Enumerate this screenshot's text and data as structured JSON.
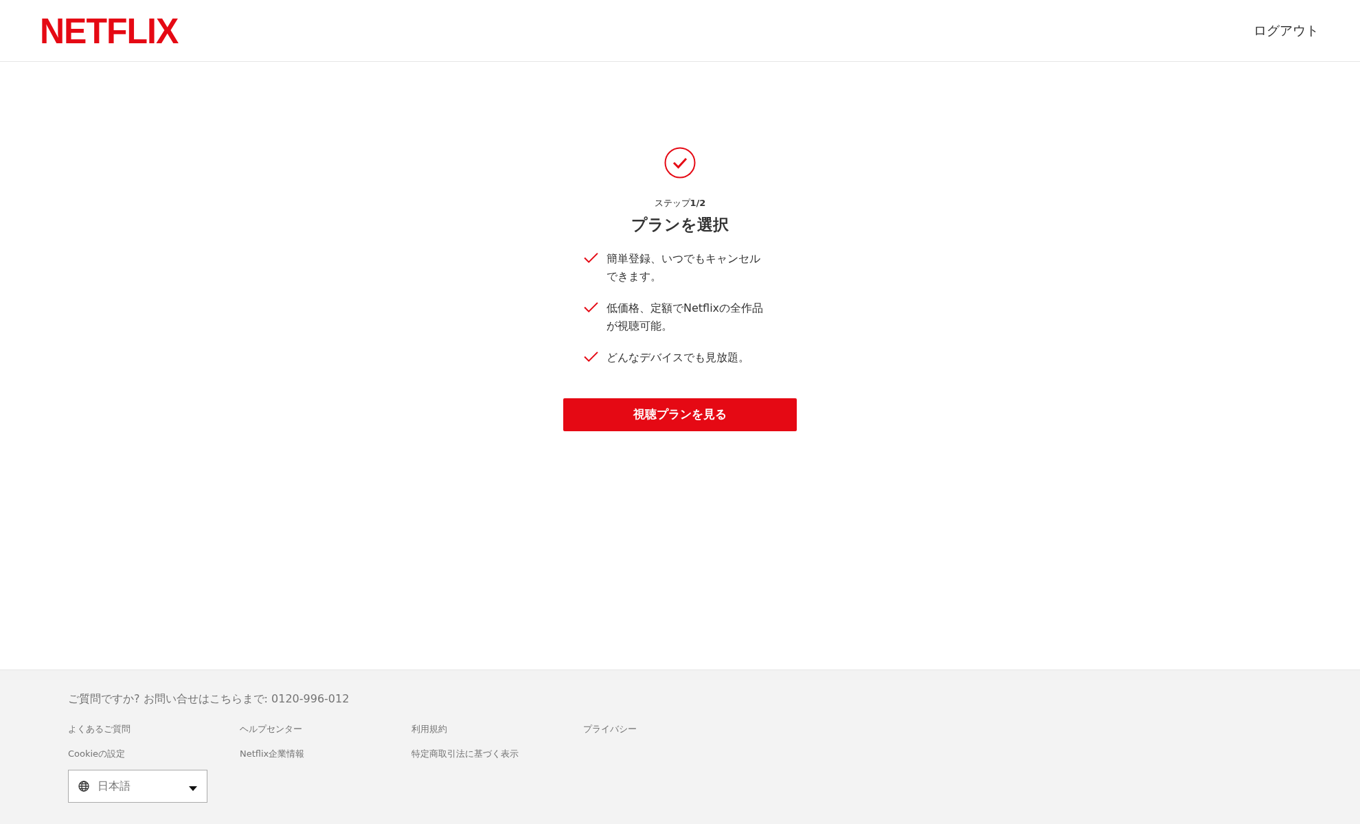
{
  "header": {
    "logo": "NETFLIX",
    "logout": "ログアウト"
  },
  "main": {
    "step": "ステップ**1/2**",
    "title": "プランを選択",
    "benefits": [
      {
        "text": "簡単登録、いつでもキャンセルできます。"
      },
      {
        "text": "低価格、定額でNetflixの全作品が視聴可能。"
      },
      {
        "text": "どんなデバイスでも見放題。"
      }
    ],
    "button": "視聴プランを見る"
  },
  "footer": {
    "contact": "ご質問ですか? お問い合せはこちらまで: 0120-996-012",
    "links": [
      "よくあるご質問",
      "ヘルプセンター",
      "利用規約",
      "プライバシー",
      "Cookieの設定",
      "Netflix企業情報",
      "特定商取引法に基づく表示"
    ],
    "language": "日本語"
  }
}
